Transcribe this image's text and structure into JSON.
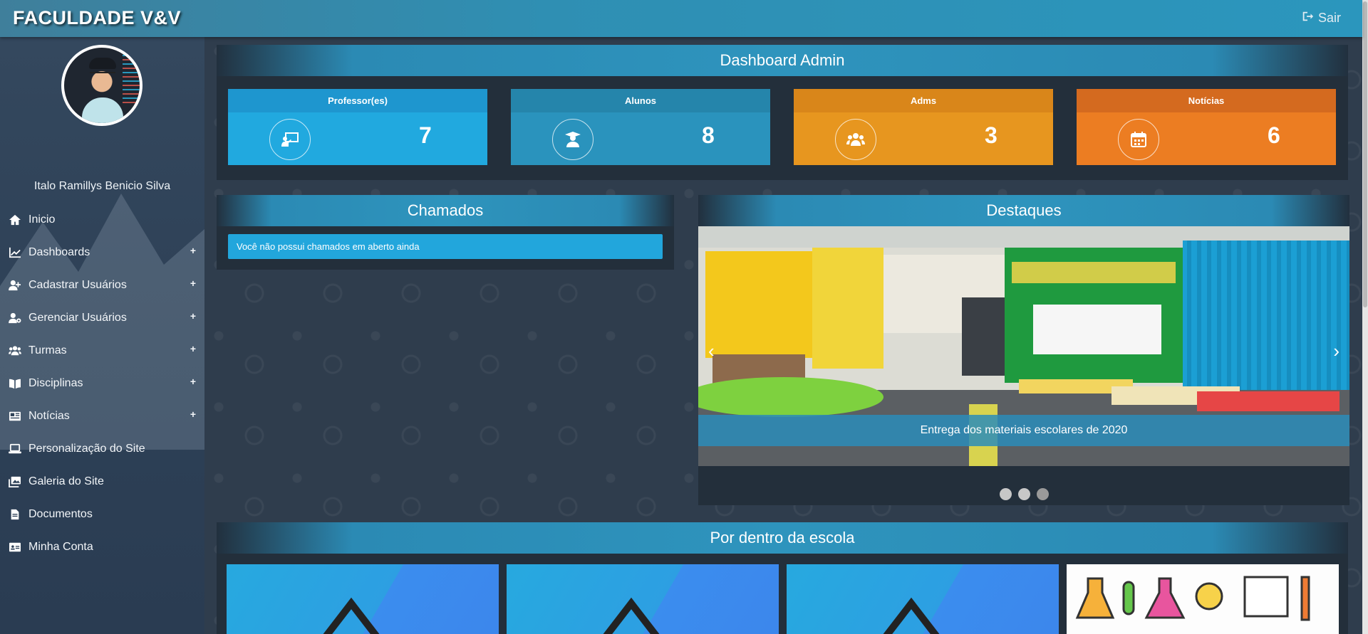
{
  "app": {
    "brand": "FACULDADE V&V",
    "logout_label": "Sair"
  },
  "user": {
    "name": "Italo Ramillys Benicio Silva"
  },
  "sidebar": {
    "items": [
      {
        "label": "Inicio",
        "icon": "home-icon",
        "expandable": false
      },
      {
        "label": "Dashboards",
        "icon": "chart-line-icon",
        "expandable": true
      },
      {
        "label": "Cadastrar Usuários",
        "icon": "user-plus-icon",
        "expandable": true
      },
      {
        "label": "Gerenciar Usuários",
        "icon": "user-cog-icon",
        "expandable": true
      },
      {
        "label": "Turmas",
        "icon": "users-icon",
        "expandable": true
      },
      {
        "label": "Disciplinas",
        "icon": "book-open-icon",
        "expandable": true
      },
      {
        "label": "Notícias",
        "icon": "newspaper-icon",
        "expandable": true
      },
      {
        "label": "Personalização do Site",
        "icon": "laptop-icon",
        "expandable": false
      },
      {
        "label": "Galeria do Site",
        "icon": "images-icon",
        "expandable": false
      },
      {
        "label": "Documentos",
        "icon": "file-icon",
        "expandable": false
      },
      {
        "label": "Minha Conta",
        "icon": "id-card-icon",
        "expandable": false
      }
    ],
    "expand_symbol": "+"
  },
  "dashboard": {
    "title": "Dashboard Admin",
    "cards": [
      {
        "title": "Professor(es)",
        "count": "7",
        "icon": "chalkboard-teacher-icon",
        "header_color": "#1e96cf",
        "body_color": "#21a9df"
      },
      {
        "title": "Alunos",
        "count": "8",
        "icon": "user-graduate-icon",
        "header_color": "#2585ab",
        "body_color": "#2a93bd"
      },
      {
        "title": "Adms",
        "count": "3",
        "icon": "users-icon",
        "header_color": "#d9861a",
        "body_color": "#e7961f"
      },
      {
        "title": "Notícias",
        "count": "6",
        "icon": "calendar-icon",
        "header_color": "#d46a1f",
        "body_color": "#ec7d22"
      }
    ]
  },
  "chamados": {
    "title": "Chamados",
    "message": "Você não possui chamados em aberto ainda"
  },
  "destaques": {
    "title": "Destaques",
    "caption": "Entrega dos materiais escolares de 2020",
    "prev_symbol": "‹",
    "next_symbol": "›",
    "dots": [
      true,
      false,
      false
    ]
  },
  "escola": {
    "title": "Por dentro da escola"
  }
}
